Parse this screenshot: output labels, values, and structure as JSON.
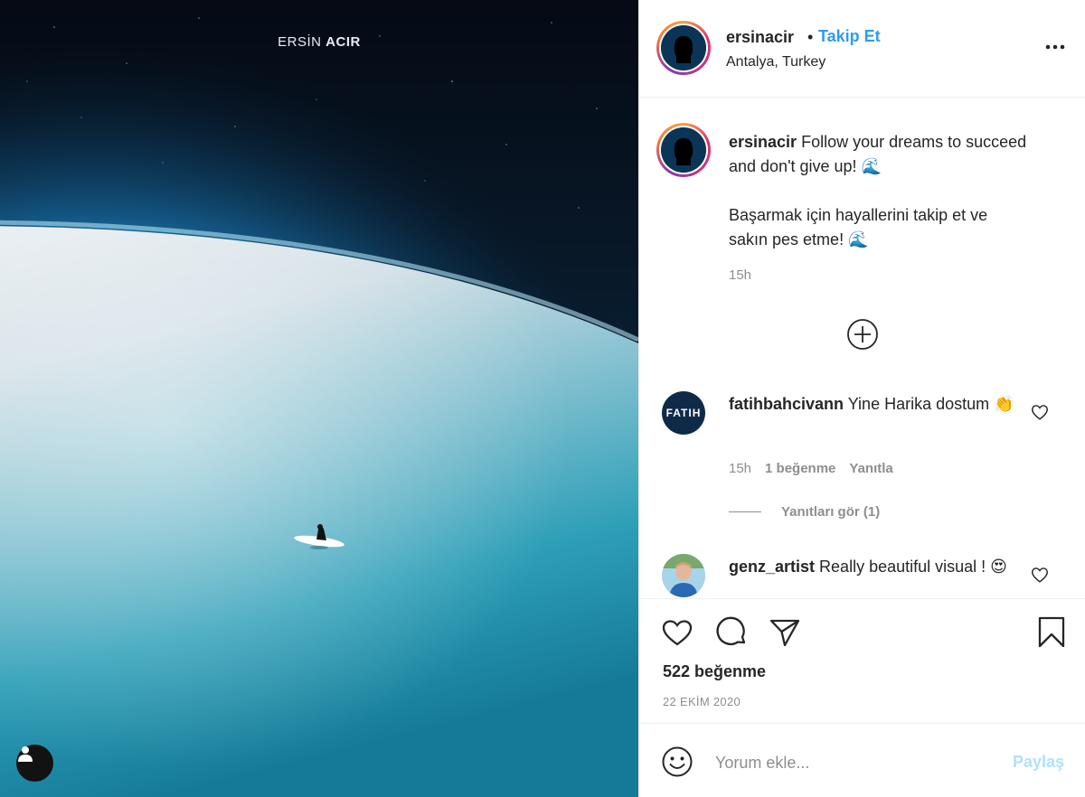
{
  "photo": {
    "watermark_first": "ERSİN",
    "watermark_last": "ACIR"
  },
  "header": {
    "username": "ersinacir",
    "separator": "•",
    "follow_label": "Takip Et",
    "location": "Antalya, Turkey"
  },
  "caption": {
    "username": "ersinacir",
    "text_en": "Follow your dreams to succeed and don't give up!",
    "text_tr": "Başarmak için hayallerini takip et ve sakın pes etme!",
    "wave_emoji": "🌊",
    "time": "15h"
  },
  "comments": [
    {
      "username": "fatihbahcivann",
      "text": "Yine Harika dostum",
      "emoji": "👏",
      "avatar_text": "FATIH",
      "time": "15h",
      "likes": "1 beğenme",
      "reply_label": "Yanıtla",
      "view_replies": "Yanıtları gör (1)"
    },
    {
      "username": "genz_artist",
      "text": "Really beautiful visual !",
      "emoji": "😍"
    }
  ],
  "actions": {
    "likes_count": "522 beğenme",
    "date": "22 EKİM 2020"
  },
  "add_comment": {
    "placeholder": "Yorum ekle...",
    "share_label": "Paylaş"
  },
  "icons": {
    "more": "more-horizontal-icon",
    "load_more": "plus-circle-icon",
    "like": "heart-icon",
    "comment": "comment-icon",
    "share": "paper-plane-icon",
    "save": "bookmark-icon",
    "emoji": "smiley-icon",
    "user_tag": "user-icon"
  }
}
